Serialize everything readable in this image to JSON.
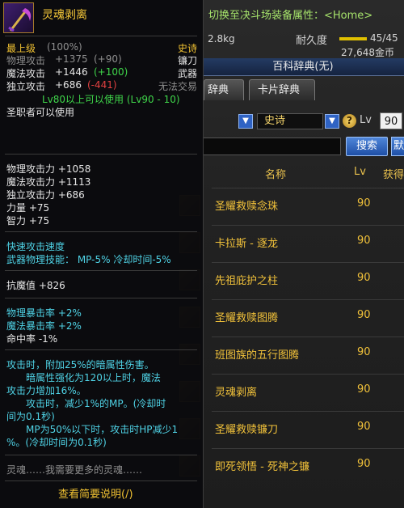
{
  "encyclopedia": {
    "title": "百科辞典(无)",
    "tabs": [
      "辞典",
      "卡片辞典"
    ],
    "filter": {
      "rarity_value": "史诗",
      "help_symbol": "?",
      "lv_label": "Lv",
      "lv_value": "90"
    },
    "search_button": "搜索",
    "extra_button": "默",
    "columns": {
      "name": "名称",
      "lv": "Lv",
      "obtain": "获得"
    },
    "rows": [
      {
        "name": "圣耀救赎念珠",
        "lv": "90"
      },
      {
        "name": "卡拉斯 - 逐龙",
        "lv": "90"
      },
      {
        "name": "先祖庇护之柱",
        "lv": "90"
      },
      {
        "name": "圣耀救赎图腾",
        "lv": "90"
      },
      {
        "name": "班图族的五行图腾",
        "lv": "90"
      },
      {
        "name": "灵魂剥离",
        "lv": "90"
      },
      {
        "name": "圣耀救赎镰刀",
        "lv": "90"
      },
      {
        "name": "即死领悟 - 死神之镰",
        "lv": "90"
      }
    ]
  },
  "item_info": {
    "switch_link": "切换至决斗场装备属性：<Home>",
    "weight": "2.8kg",
    "durability_label": "耐久度",
    "durability_value": "45/45",
    "durability_fraction": 1.0,
    "gold": "27,648金币"
  },
  "tooltip": {
    "title": "灵魂剥离",
    "grade": "最上级",
    "grade_pct": "(100%)",
    "rarity": "史诗",
    "weapon_type": "镰刀",
    "category": "武器",
    "phys_atk_label": "物理攻击",
    "phys_atk_value": "+1375",
    "phys_atk_diff": "(+90)",
    "mag_atk_label": "魔法攻击",
    "mag_atk_value": "+1446",
    "mag_atk_diff": "(+100)",
    "indep_atk_label": "独立攻击",
    "indep_atk_value": "+686",
    "indep_atk_diff": "(-441)",
    "untradeable": "无法交易",
    "level_req": "Lv80以上可以使用 (Lv90 - 10)",
    "class_req": "圣职者可以使用",
    "stats": [
      "物理攻击力 +1058",
      "魔法攻击力 +1113",
      "独立攻击力 +686",
      "力量 +75",
      "智力 +75"
    ],
    "speed_line": "快速攻击速度",
    "skill_line": "武器物理技能： MP-5% 冷却时间-5%",
    "magic_resist": "抗魔值 +826",
    "crit_phys": "物理暴击率 +2%",
    "crit_mag": "魔法暴击率 +2%",
    "hit_rate": "命中率 -1%",
    "effect_lines": [
      "攻击时，附加25%的暗属性伤害。",
      "暗属性强化为120以上时，魔法",
      "攻击力增加16%。",
      "攻击时，减少1%的MP。(冷却时",
      "间为0.1秒)",
      "MP为50%以下时，攻击时HP减少1",
      "%。(冷却时间为0.1秒)"
    ],
    "flavor": "灵魂……我需要更多的灵魂……",
    "footer": "查看简要说明(/)"
  },
  "colors": {
    "gold": "#f1c232",
    "green": "#3fd64a",
    "red": "#e04040",
    "cyan": "#4fd3e6",
    "link_green": "#a6e36b"
  }
}
